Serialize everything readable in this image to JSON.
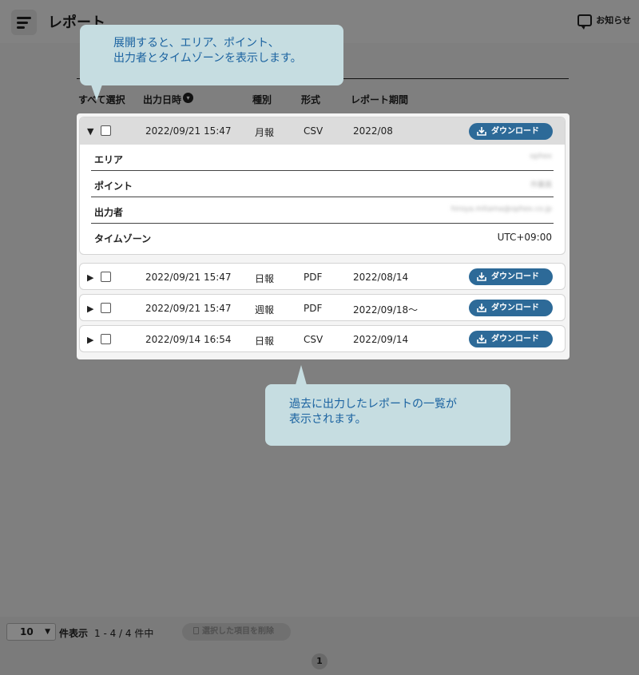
{
  "header": {
    "title": "レポート",
    "notice_label": "お知らせ"
  },
  "columns": {
    "select_all": "すべて選択",
    "output_datetime": "出力日時",
    "type": "種別",
    "format": "形式",
    "period": "レポート期間"
  },
  "rows": [
    {
      "datetime": "2022/09/21 15:47",
      "type": "月報",
      "format": "CSV",
      "period": "2022/08",
      "expanded": true
    },
    {
      "datetime": "2022/09/21 15:47",
      "type": "日報",
      "format": "PDF",
      "period": "2022/08/14",
      "expanded": false
    },
    {
      "datetime": "2022/09/21 15:47",
      "type": "週報",
      "format": "PDF",
      "period": "2022/09/18〜",
      "expanded": false
    },
    {
      "datetime": "2022/09/14 16:54",
      "type": "日報",
      "format": "CSV",
      "period": "2022/09/14",
      "expanded": false
    }
  ],
  "download_label": "ダウンロード",
  "details": [
    {
      "label": "エリア",
      "value": "ophex"
    },
    {
      "label": "ポイント",
      "value": "作業員"
    },
    {
      "label": "出力者",
      "value": "hiroya.mitama@ophex.co.jp"
    },
    {
      "label": "タイムゾーン",
      "value": "UTC+09:00"
    }
  ],
  "footer": {
    "per_page": "10",
    "per_page_label": "件表示",
    "range": "1 - 4 / 4 件中",
    "delete_label": "選択した項目を削除",
    "page": "1"
  },
  "callouts": {
    "top": [
      "展開すると、エリア、ポイント、",
      "出力者とタイムゾーンを表示します。"
    ],
    "bottom": [
      "過去に出力したレポートの一覧が",
      "表示されます。"
    ]
  },
  "colors": {
    "accent": "#2d6a98",
    "callout_bg": "#c6dde1",
    "callout_text": "#1a62a0"
  }
}
